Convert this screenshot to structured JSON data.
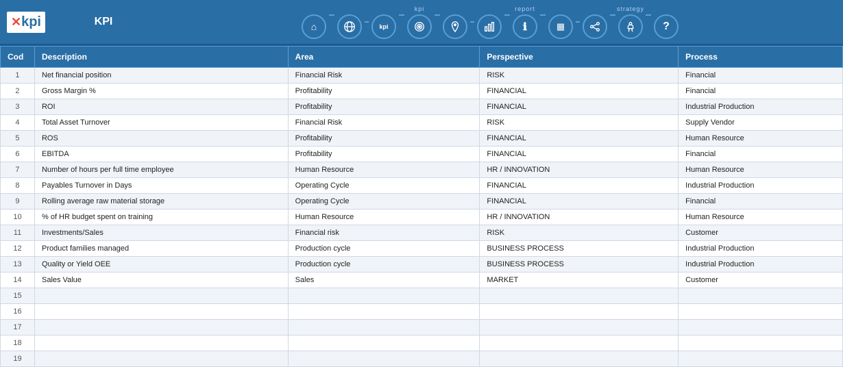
{
  "header": {
    "logo_text": "kpi",
    "logo_x": "x",
    "title": "KPI",
    "nav": {
      "groups": [
        {
          "label": "",
          "icons": [
            {
              "name": "home",
              "symbol": "⌂",
              "active": false
            },
            {
              "name": "network",
              "symbol": "⬡",
              "active": false
            }
          ]
        },
        {
          "label": "kpi",
          "icons": [
            {
              "name": "kpi",
              "symbol": "kpi",
              "active": false
            },
            {
              "name": "target",
              "symbol": "◎",
              "active": false
            },
            {
              "name": "location",
              "symbol": "⚑",
              "active": false
            }
          ]
        },
        {
          "label": "report",
          "icons": [
            {
              "name": "chart",
              "symbol": "📊",
              "active": false
            },
            {
              "name": "info",
              "symbol": "ℹ",
              "active": false
            },
            {
              "name": "calendar",
              "symbol": "▦",
              "active": false
            }
          ]
        },
        {
          "label": "strategy",
          "icons": [
            {
              "name": "share",
              "symbol": "⇶",
              "active": false
            },
            {
              "name": "figure",
              "symbol": "☆",
              "active": false
            },
            {
              "name": "help",
              "symbol": "?",
              "active": false
            }
          ]
        }
      ]
    }
  },
  "table": {
    "columns": [
      "Cod",
      "Description",
      "Area",
      "Perspective",
      "Process"
    ],
    "rows": [
      {
        "cod": "1",
        "description": "Net financial position",
        "area": "Financial Risk",
        "perspective": "RISK",
        "process": "Financial"
      },
      {
        "cod": "2",
        "description": "Gross Margin %",
        "area": "Profitability",
        "perspective": "FINANCIAL",
        "process": "Financial"
      },
      {
        "cod": "3",
        "description": "ROI",
        "area": "Profitability",
        "perspective": "FINANCIAL",
        "process": "Industrial Production"
      },
      {
        "cod": "4",
        "description": "Total Asset Turnover",
        "area": "Financial Risk",
        "perspective": "RISK",
        "process": "Supply Vendor"
      },
      {
        "cod": "5",
        "description": "ROS",
        "area": "Profitability",
        "perspective": "FINANCIAL",
        "process": "Human Resource"
      },
      {
        "cod": "6",
        "description": "EBITDA",
        "area": "Profitability",
        "perspective": "FINANCIAL",
        "process": "Financial"
      },
      {
        "cod": "7",
        "description": "Number of hours per full time employee",
        "area": "Human Resource",
        "perspective": "HR / INNOVATION",
        "process": "Human Resource"
      },
      {
        "cod": "8",
        "description": "Payables Turnover in Days",
        "area": "Operating Cycle",
        "perspective": "FINANCIAL",
        "process": "Industrial Production"
      },
      {
        "cod": "9",
        "description": "Rolling average raw material storage",
        "area": "Operating Cycle",
        "perspective": "FINANCIAL",
        "process": "Financial"
      },
      {
        "cod": "10",
        "description": "% of HR budget spent on training",
        "area": "Human Resource",
        "perspective": "HR / INNOVATION",
        "process": "Human Resource"
      },
      {
        "cod": "11",
        "description": "Investments/Sales",
        "area": "Financial risk",
        "perspective": "RISK",
        "process": "Customer"
      },
      {
        "cod": "12",
        "description": "Product families managed",
        "area": "Production cycle",
        "perspective": "BUSINESS PROCESS",
        "process": "Industrial Production"
      },
      {
        "cod": "13",
        "description": "Quality or Yield OEE",
        "area": "Production cycle",
        "perspective": "BUSINESS PROCESS",
        "process": "Industrial Production"
      },
      {
        "cod": "14",
        "description": "Sales Value",
        "area": "Sales",
        "perspective": "MARKET",
        "process": "Customer"
      },
      {
        "cod": "15",
        "description": "",
        "area": "",
        "perspective": "",
        "process": ""
      },
      {
        "cod": "16",
        "description": "",
        "area": "",
        "perspective": "",
        "process": ""
      },
      {
        "cod": "17",
        "description": "",
        "area": "",
        "perspective": "",
        "process": ""
      },
      {
        "cod": "18",
        "description": "",
        "area": "",
        "perspective": "",
        "process": ""
      },
      {
        "cod": "19",
        "description": "",
        "area": "",
        "perspective": "",
        "process": ""
      }
    ]
  }
}
